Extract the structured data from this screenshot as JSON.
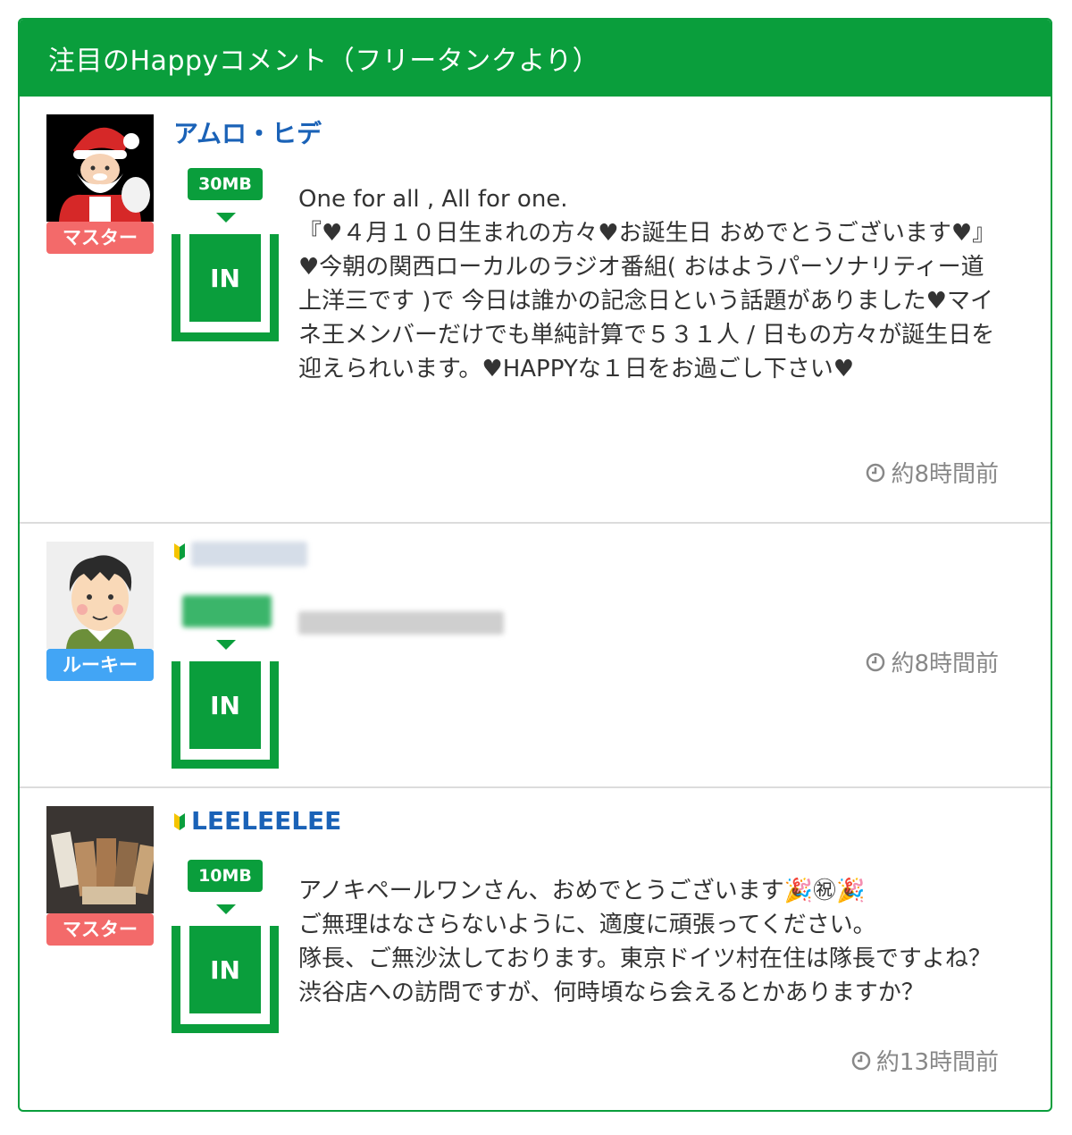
{
  "header": {
    "title": "注目のHappyコメント（フリータンクより）"
  },
  "entries": [
    {
      "username": "アムロ・ヒデ",
      "rank_badge": "マスター",
      "data_tag": "30MB",
      "in_label": "IN",
      "comment": "One for all , All for one.\n『♥４月１０日生まれの方々♥お誕生日 おめでとうございます♥』\n♥今朝の関西ローカルのラジオ番組( おはようパーソナリティー道上洋三です )で 今日は誰かの記念日という話題がありました♥マイネ王メンバーだけでも単純計算で５３１人 / 日もの方々が誕生日を迎えられいます。♥HAPPYな１日をお過ごし下さい♥",
      "time": "約8時間前",
      "avatar_icon": "santa-avatar-icon"
    },
    {
      "username": "",
      "rank_badge": "ルーキー",
      "data_tag": "",
      "in_label": "IN",
      "comment": "",
      "time": "約8時間前",
      "avatar_icon": "man-avatar-icon"
    },
    {
      "username": "LEELEELEE",
      "rank_badge": "マスター",
      "data_tag": "10MB",
      "in_label": "IN",
      "comment": "アノキペールワンさん、おめでとうございます🎉㊗🎉\nご無理はなさらないように、適度に頑張ってください。\n隊長、ご無沙汰しております。東京ドイツ村在住は隊長ですよね？\n渋谷店への訪問ですが、何時頃なら会えるとかありますか？",
      "time": "約13時間前",
      "avatar_icon": "photo-avatar-icon"
    }
  ],
  "colors": {
    "accent": "#0a9e3c",
    "username": "#1a62b7",
    "master": "#f36a6a",
    "rookie": "#42a5f5"
  }
}
